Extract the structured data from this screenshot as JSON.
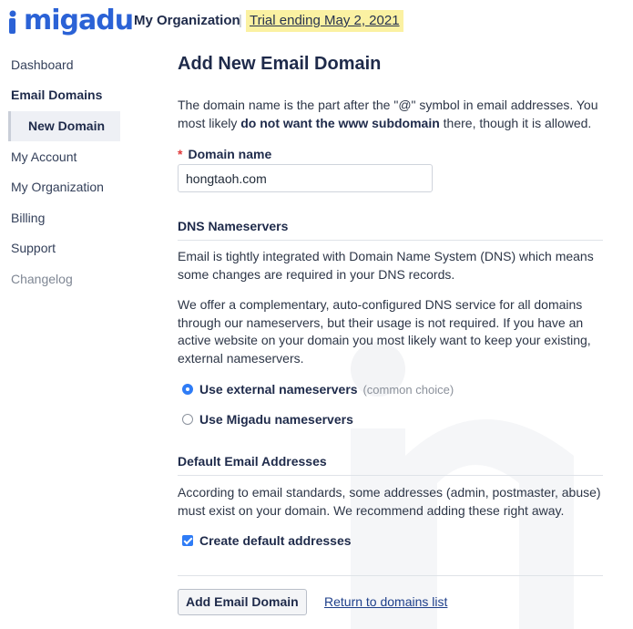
{
  "header": {
    "logo_text": "migadu",
    "org_name": "My Organization",
    "separator": "|",
    "trial_text": "Trial ending May 2, 2021"
  },
  "sidebar": {
    "items": [
      {
        "label": "Dashboard"
      },
      {
        "label": "Email Domains"
      },
      {
        "label": "New Domain"
      },
      {
        "label": "My Account"
      },
      {
        "label": "My Organization"
      },
      {
        "label": "Billing"
      },
      {
        "label": "Support"
      },
      {
        "label": "Changelog"
      }
    ]
  },
  "main": {
    "title": "Add New Email Domain",
    "intro_pre": "The domain name is the part after the \"@\" symbol in email addresses. You most likely ",
    "intro_bold": "do not want the www subdomain",
    "intro_post": " there, though it is allowed.",
    "domain_field": {
      "required_mark": "*",
      "label": "Domain name",
      "value": "hongtaoh.com"
    },
    "dns": {
      "heading": "DNS Nameservers",
      "para1": "Email is tightly integrated with Domain Name System (DNS) which means some changes are required in your DNS records.",
      "para2": "We offer a complementary, auto-configured DNS service for all domains through our nameservers, but their usage is not required. If you have an active website on your domain you most likely want to keep your existing, external nameservers.",
      "option_external": "Use external nameservers",
      "option_external_hint": "(common choice)",
      "option_migadu": "Use Migadu nameservers",
      "selected": "external"
    },
    "defaults": {
      "heading": "Default Email Addresses",
      "para": "According to email standards, some addresses (admin, postmaster, abuse) must exist on your domain. We recommend adding these right away.",
      "checkbox_label": "Create default addresses",
      "checked": true
    },
    "actions": {
      "submit_label": "Add Email Domain",
      "return_link": "Return to domains list"
    }
  },
  "colors": {
    "brand_blue": "#2b62d6",
    "trial_highlight": "#fbf1a2",
    "control_accent": "#2f7cf6",
    "required_red": "#e0393a"
  }
}
